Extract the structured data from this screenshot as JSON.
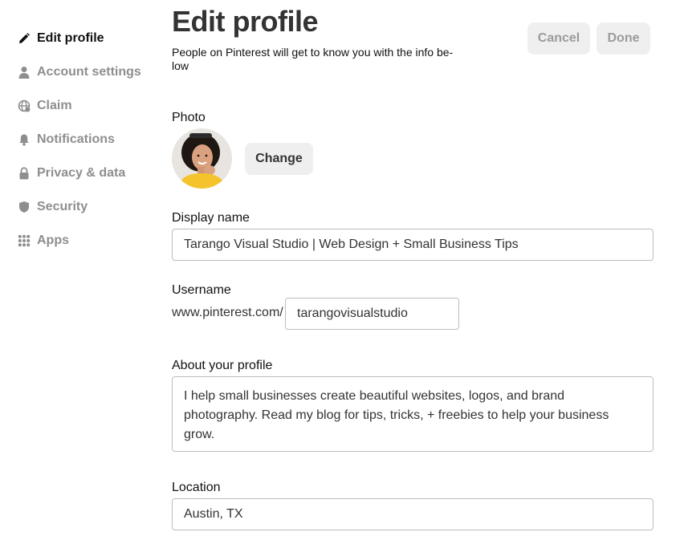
{
  "sidebar": {
    "items": [
      {
        "label": "Edit profile",
        "icon": "pencil-icon",
        "active": true
      },
      {
        "label": "Account settings",
        "icon": "person-icon",
        "active": false
      },
      {
        "label": "Claim",
        "icon": "globe-icon",
        "active": false
      },
      {
        "label": "Notifications",
        "icon": "bell-icon",
        "active": false
      },
      {
        "label": "Privacy & data",
        "icon": "lock-icon",
        "active": false
      },
      {
        "label": "Security",
        "icon": "shield-icon",
        "active": false
      },
      {
        "label": "Apps",
        "icon": "grid-icon",
        "active": false
      }
    ]
  },
  "header": {
    "title": "Edit profile",
    "subtitle": "People on Pinterest will get to know you with the info be-low",
    "cancel_label": "Cancel",
    "done_label": "Done"
  },
  "photo": {
    "label": "Photo",
    "change_label": "Change"
  },
  "display_name": {
    "label": "Display name",
    "value": "Tarango Visual Studio | Web Design + Small Business Tips"
  },
  "username": {
    "label": "Username",
    "prefix": "www.pinterest.com/",
    "value": "tarangovisualstudio"
  },
  "about": {
    "label": "About your profile",
    "value": "I help small businesses create beautiful websites, logos, and brand photography. Read my blog for tips, tricks, + freebies to help your business grow."
  },
  "location": {
    "label": "Location",
    "value": "Austin, TX"
  },
  "colors": {
    "active_text": "#111111",
    "inactive_text": "#8e8e8e",
    "button_bg": "#efefef",
    "input_border": "#bdbdbd"
  }
}
